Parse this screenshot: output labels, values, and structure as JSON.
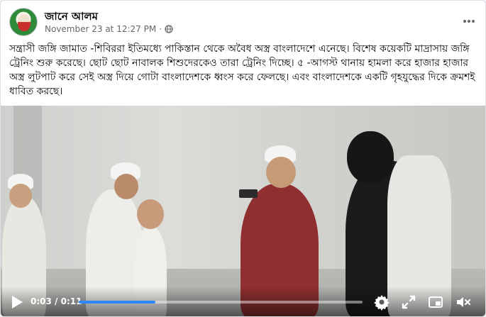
{
  "post": {
    "author": "জানে আলম",
    "timestamp": "November 23 at 12:27 PM",
    "separator": "·",
    "text": "সন্ত্রাসী জঙ্গি জামাত -শিবিররা ইতিমধ্যে পাকিস্তান থেকে অবৈধ অস্ত্র বাংলাদেশে এনেছে। বিশেষ কয়েকটি মাদ্রাসায় জঙ্গি ট্রেনিং শুরু করেছে। ছোট ছোট নাবালক শিশুদেরকেও তারা ট্রেনিং দিচ্ছে। ৫ -আগস্ট থানায় হামলা করে হাজার হাজার অস্ত্র লুটপাট করে সেই অস্ত্র দিয়ে গোটা বাংলাদেশকে ধ্বংস করে ফেলছে। এবং বাংলাদেশকে একটি গৃহযুদ্ধের দিকে ক্রমশই ধাবিত করছে।"
  },
  "video": {
    "current_time": "0:03",
    "duration": "0:11",
    "time_separator": " / ",
    "progress": 0.27
  },
  "icons": {
    "avatar": "avatar",
    "privacy": "globe-icon",
    "more": "more-options-icon",
    "play": "play-icon",
    "settings": "gear-icon",
    "fullscreen": "expand-icon",
    "miniplayer": "pip-icon",
    "volume": "muted-speaker-icon"
  },
  "colors": {
    "text": "#050505",
    "meta": "#65676b",
    "progress": "#2d88ff"
  }
}
